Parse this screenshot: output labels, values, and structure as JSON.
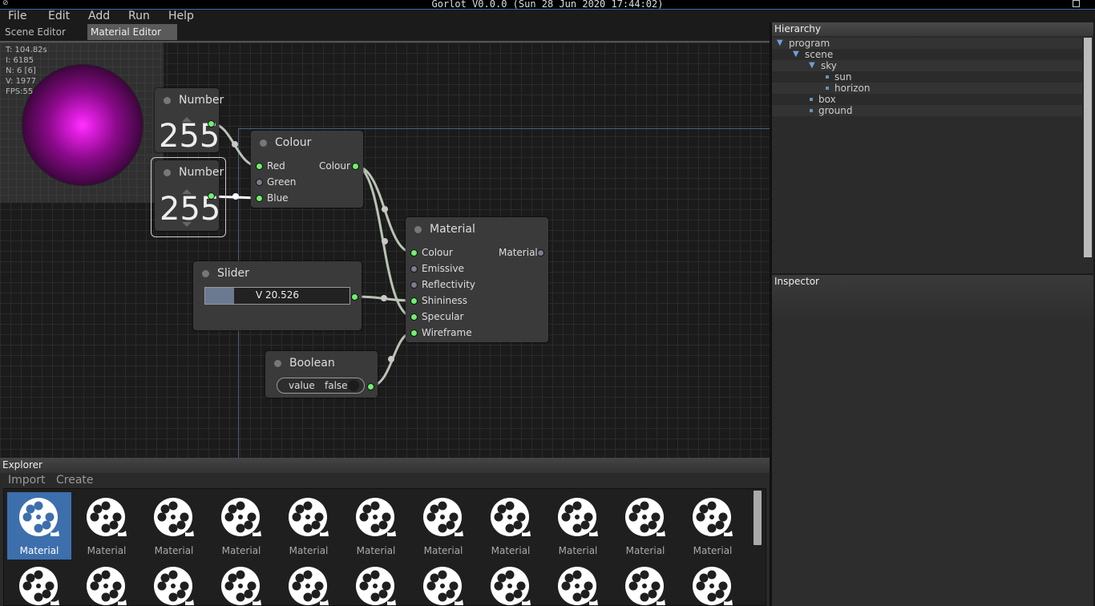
{
  "app": {
    "title": "Gorlot V0.0.0 (Sun 28 Jun 2020 17:44:02)"
  },
  "menu": [
    "File",
    "Edit",
    "Add",
    "Run",
    "Help"
  ],
  "tabs": [
    {
      "label": "Scene Editor 0",
      "close": "×"
    },
    {
      "label": "Material Editor 0",
      "close": "×"
    }
  ],
  "preview": {
    "stats": [
      "T: 104.82s",
      "I: 6185",
      "N: 6 [6]",
      "V: 1977",
      "FPS:55"
    ]
  },
  "nodes": {
    "number1": {
      "title": "Number",
      "value": "255"
    },
    "number2": {
      "title": "Number",
      "value": "255"
    },
    "colour": {
      "title": "Colour",
      "inputs": [
        "Red",
        "Green",
        "Blue"
      ],
      "output": "Colour"
    },
    "material": {
      "title": "Material",
      "inputs": [
        "Colour",
        "Emissive",
        "Reflectivity",
        "Shininess",
        "Specular",
        "Wireframe"
      ],
      "output": "Material"
    },
    "slider": {
      "title": "Slider",
      "text": "V  20.526",
      "level": 0.2
    },
    "boolean": {
      "title": "Boolean",
      "label": "value",
      "value": "false"
    }
  },
  "explorer": {
    "title": "Explorer",
    "tools": [
      "Import",
      "Create"
    ],
    "item_label": "Material"
  },
  "hierarchy": {
    "title": "Hierarchy",
    "items": [
      "program",
      "scene",
      "sky",
      "sun",
      "horizon",
      "box",
      "ground"
    ]
  },
  "inspector": {
    "title": "Inspector"
  },
  "colors": {
    "accent": "#3d6fad",
    "port_on": "#6ef06e",
    "port_off": "#7d7d8a",
    "sphere": "#ff33ff"
  },
  "icons": {
    "explorer_item": "film-reel-icon"
  }
}
